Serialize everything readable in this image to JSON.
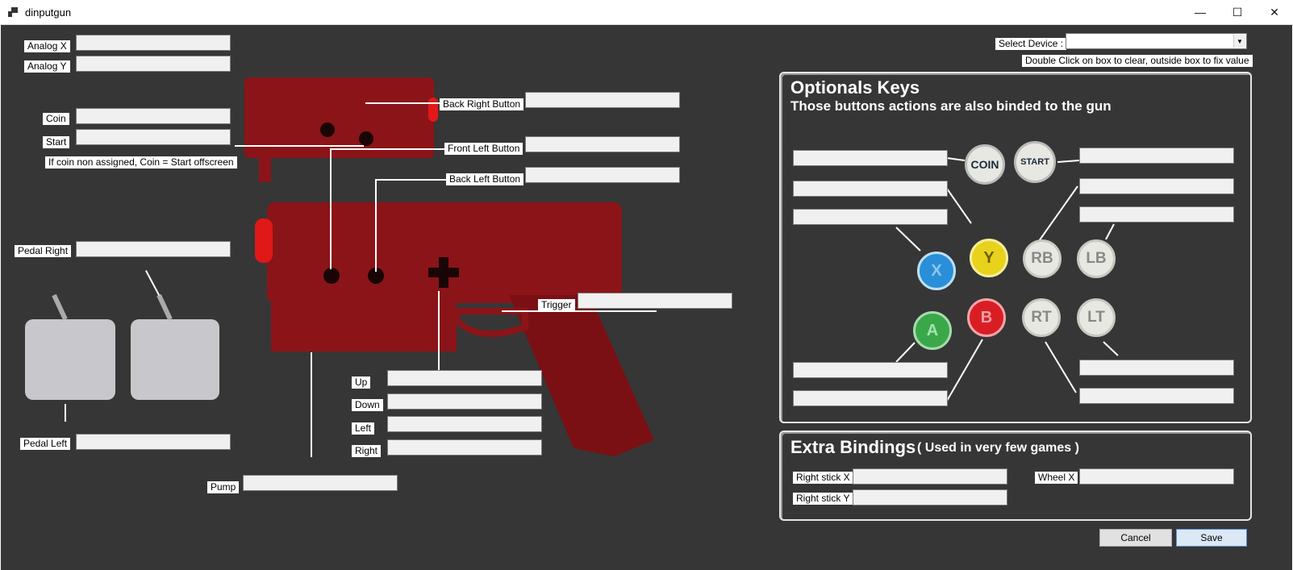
{
  "window": {
    "title": "dinputgun",
    "minimize": "—",
    "maximize": "☐",
    "close": "✕"
  },
  "left_labels": {
    "analog_x": "Analog X",
    "analog_y": "Analog Y",
    "coin": "Coin",
    "start": "Start",
    "coin_note": "If coin non assigned, Coin = Start offscreen",
    "pedal_right": "Pedal Right",
    "pedal_left": "Pedal Left"
  },
  "gun_labels": {
    "back_right": "Back Right Button",
    "front_left": "Front Left Button",
    "back_left": "Back Left Button",
    "trigger": "Trigger",
    "up": "Up",
    "down": "Down",
    "left": "Left",
    "right": "Right",
    "pump": "Pump"
  },
  "device": {
    "label": "Select Device :",
    "value": "",
    "hint": "Double Click on box to clear, outside box to fix value"
  },
  "optional": {
    "title": "Optionals Keys",
    "subtitle": "Those buttons actions are also binded to the gun",
    "buttons": {
      "coin": "COIN",
      "start": "START",
      "x": "X",
      "y": "Y",
      "rb": "RB",
      "lb": "LB",
      "a": "A",
      "b": "B",
      "rt": "RT",
      "lt": "LT"
    }
  },
  "extra": {
    "title": "Extra Bindings",
    "subtitle": "( Used in very few games )",
    "right_stick_x": "Right stick X",
    "right_stick_y": "Right stick Y",
    "wheel_x": "Wheel X"
  },
  "footer": {
    "cancel": "Cancel",
    "save": "Save"
  },
  "colors": {
    "gun": "#8b1418",
    "x": "#2a8fd8",
    "y": "#e8d21c",
    "a": "#3aa84a",
    "b": "#d81e24",
    "neutral": "#e8e8e2"
  }
}
